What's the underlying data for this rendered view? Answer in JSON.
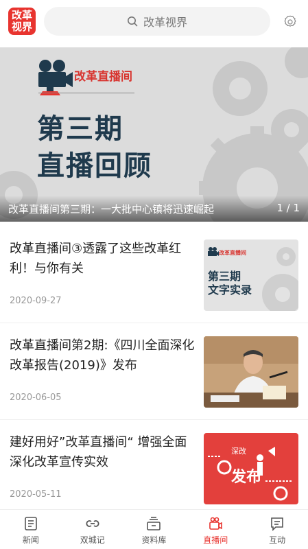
{
  "header": {
    "logo_line1": "改革",
    "logo_line2": "视界",
    "search_placeholder": "改革视界"
  },
  "banner": {
    "tag": "改革直播间",
    "title_line1": "第三期",
    "title_line2": "直播回顾",
    "caption": "改革直播间第三期：一大批中心镇将迅速崛起",
    "pager": "1 / 1"
  },
  "articles": [
    {
      "title": "改革直播间③透露了这些改革红利！与你有关",
      "date": "2020-09-27",
      "thumb_tag": "改革直播间",
      "thumb_line1": "第三期",
      "thumb_line2": "文字实录"
    },
    {
      "title": "改革直播间第2期:《四川全面深化改革报告(2019)》发布",
      "date": "2020-06-05"
    },
    {
      "title": "建好用好”改革直播间“ 增强全面深化改革宣传实效",
      "date": "2020-05-11",
      "thumb_line1": "深改",
      "thumb_line2": "发布"
    }
  ],
  "nav": {
    "items": [
      {
        "label": "新闻",
        "icon": "news-icon"
      },
      {
        "label": "双城记",
        "icon": "link-icon"
      },
      {
        "label": "资料库",
        "icon": "archive-icon"
      },
      {
        "label": "直播间",
        "icon": "video-camera-icon",
        "active": true
      },
      {
        "label": "互动",
        "icon": "message-icon"
      }
    ]
  },
  "colors": {
    "accent": "#e8342f",
    "title_dark": "#1f3a4d"
  }
}
